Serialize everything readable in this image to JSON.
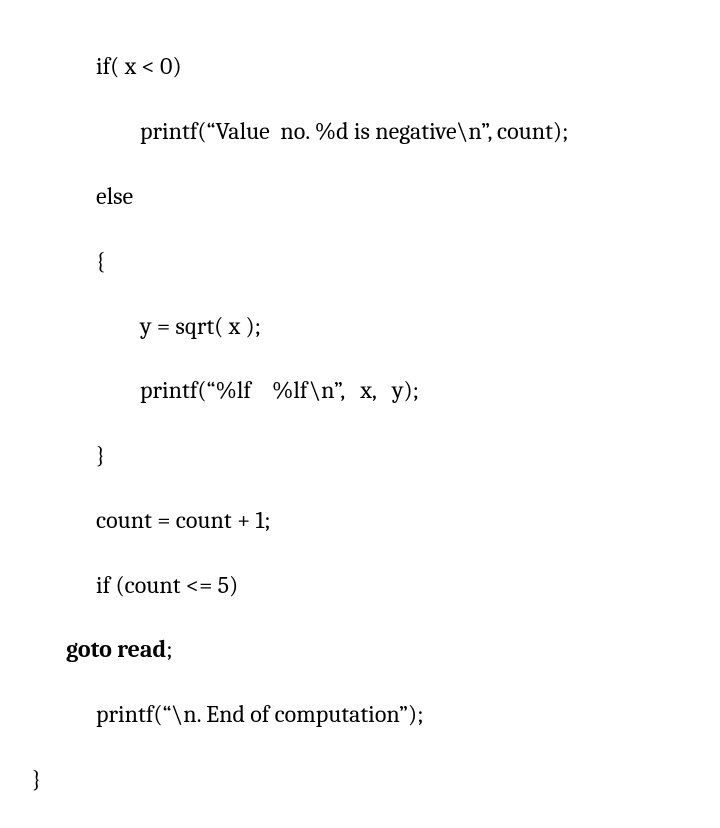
{
  "code": {
    "l1": "if( x < 0)",
    "l2": "printf(“Value  no. %d is negative\\n”, count);",
    "l3": "else",
    "l4": "{",
    "l5": "y = sqrt( x );",
    "l6": "printf(“%lf    %lf\\n”,   x,   y);",
    "l7": "}",
    "l8": "count = count + 1;",
    "l9": "if (count <= 5)",
    "l10_bold": "goto read",
    "l10_tail": ";",
    "l11": "printf(“\\n. End of computation”);",
    "l12": "}"
  }
}
